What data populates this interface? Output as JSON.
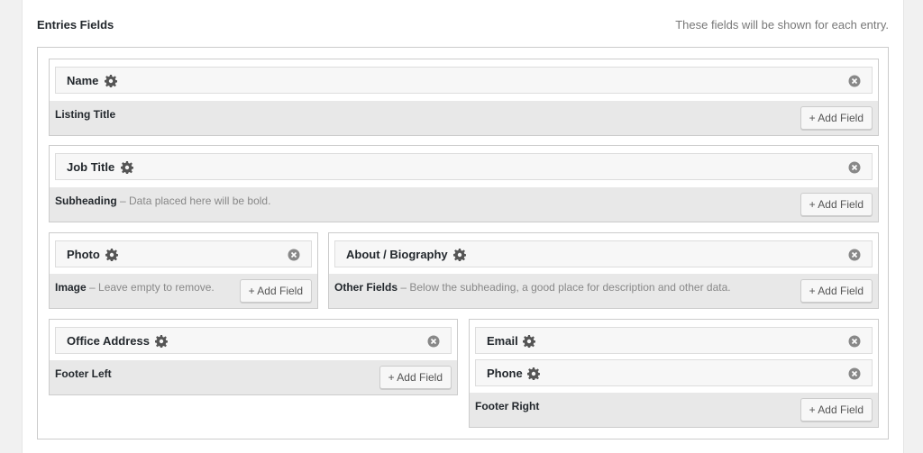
{
  "header": {
    "title": "Entries Fields",
    "hint": "These fields will be shown for each entry."
  },
  "add_field_label": "+ Add Field",
  "icons": {
    "settings": "gear-icon",
    "remove": "close-circle-icon"
  },
  "zones": {
    "listing_title": {
      "name": "Listing Title",
      "desc": "",
      "fields": [
        "Name"
      ]
    },
    "subheading": {
      "name": "Subheading",
      "desc": " – Data placed here will be bold.",
      "fields": [
        "Job Title"
      ]
    },
    "image": {
      "name": "Image",
      "desc": " – Leave empty to remove.",
      "fields": [
        "Photo"
      ]
    },
    "other_fields": {
      "name": "Other Fields",
      "desc": " – Below the subheading, a good place for description and other data.",
      "fields": [
        "About / Biography"
      ]
    },
    "footer_left": {
      "name": "Footer Left",
      "desc": "",
      "fields": [
        "Office Address"
      ]
    },
    "footer_right": {
      "name": "Footer Right",
      "desc": "",
      "fields": [
        "Email",
        "Phone"
      ]
    }
  }
}
